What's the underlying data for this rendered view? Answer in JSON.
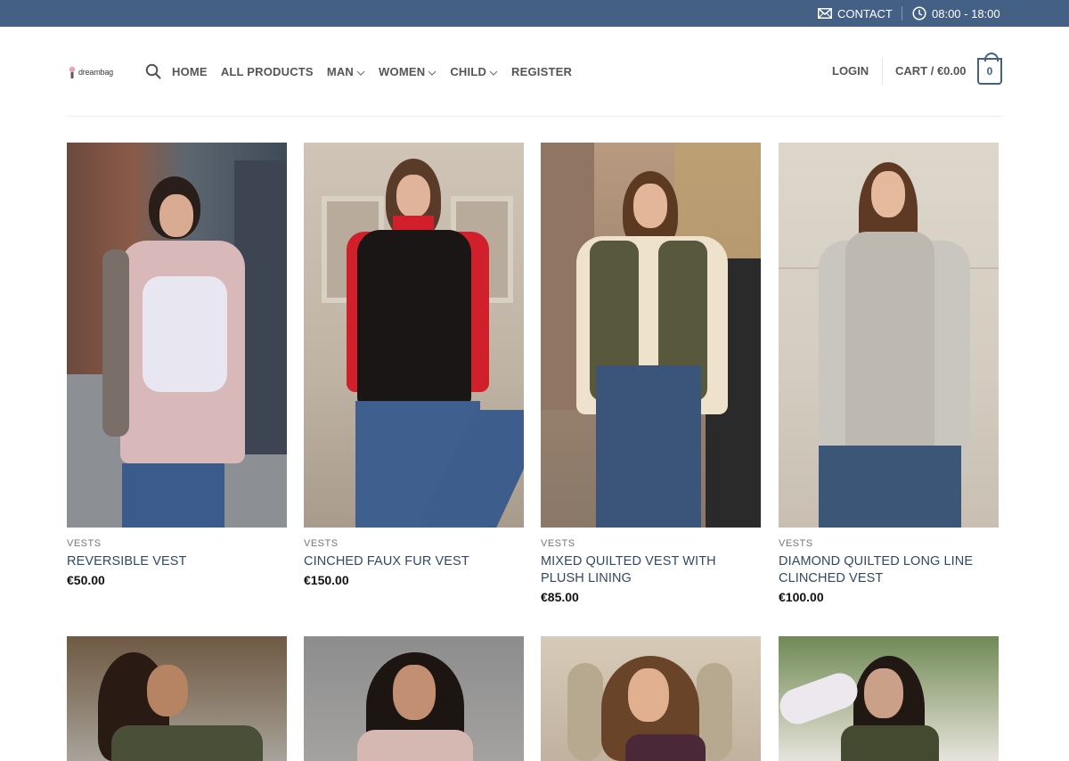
{
  "topbar": {
    "contact_label": "CONTACT",
    "contact_icon": "envelope-icon",
    "hours_label": "08:00 - 18:00",
    "hours_icon": "clock-icon",
    "background_color": "#446084"
  },
  "header": {
    "logo_text": "dreambag",
    "search_icon": "search-icon",
    "nav": [
      {
        "label": "HOME",
        "has_dropdown": false
      },
      {
        "label": "ALL PRODUCTS",
        "has_dropdown": false
      },
      {
        "label": "MAN",
        "has_dropdown": true
      },
      {
        "label": "WOMEN",
        "has_dropdown": true
      },
      {
        "label": "CHILD",
        "has_dropdown": true
      },
      {
        "label": "REGISTER",
        "has_dropdown": false
      }
    ],
    "login_label": "LOGIN",
    "cart_label": "CART / €0.00",
    "cart_count": "0",
    "accent_color": "#446084"
  },
  "products": [
    {
      "category": "VESTS",
      "name": "REVERSIBLE VEST",
      "price": "€50.00"
    },
    {
      "category": "VESTS",
      "name": "CINCHED FAUX FUR VEST",
      "price": "€150.00"
    },
    {
      "category": "VESTS",
      "name": "MIXED QUILTED VEST WITH PLUSH LINING",
      "price": "€85.00"
    },
    {
      "category": "VESTS",
      "name": "DIAMOND QUILTED LONG LINE CLINCHED VEST",
      "price": "€100.00"
    }
  ]
}
